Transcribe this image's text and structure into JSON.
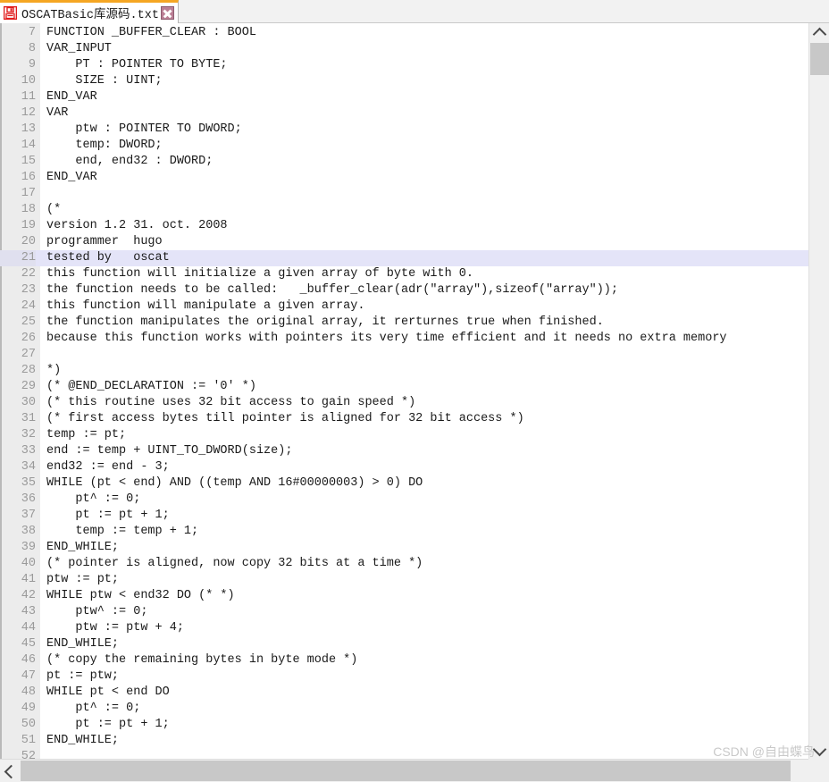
{
  "window": {
    "tab": {
      "title": "OSCATBasic库源码.txt",
      "icon": "save-floppy-icon",
      "close_label": "×",
      "active_indicator_color": "#f5a623"
    }
  },
  "editor": {
    "gutter_color": "#ececec",
    "line_number_color": "#9a9a9a",
    "highlight_color": "#e4e4f8",
    "current_line": 21,
    "first_visible_line": 7,
    "last_visible_line": 52,
    "lines": [
      {
        "n": "7",
        "text": "FUNCTION _BUFFER_CLEAR : BOOL"
      },
      {
        "n": "8",
        "text": "VAR_INPUT"
      },
      {
        "n": "9",
        "text": "    PT : POINTER TO BYTE;"
      },
      {
        "n": "10",
        "text": "    SIZE : UINT;"
      },
      {
        "n": "11",
        "text": "END_VAR"
      },
      {
        "n": "12",
        "text": "VAR"
      },
      {
        "n": "13",
        "text": "    ptw : POINTER TO DWORD;"
      },
      {
        "n": "14",
        "text": "    temp: DWORD;"
      },
      {
        "n": "15",
        "text": "    end, end32 : DWORD;"
      },
      {
        "n": "16",
        "text": "END_VAR"
      },
      {
        "n": "17",
        "text": ""
      },
      {
        "n": "18",
        "text": "(*"
      },
      {
        "n": "19",
        "text": "version 1.2 31. oct. 2008"
      },
      {
        "n": "20",
        "text": "programmer  hugo"
      },
      {
        "n": "21",
        "text": "tested by   oscat"
      },
      {
        "n": "22",
        "text": "this function will initialize a given array of byte with 0."
      },
      {
        "n": "23",
        "text": "the function needs to be called:   _buffer_clear(adr(\"array\"),sizeof(\"array\"));"
      },
      {
        "n": "24",
        "text": "this function will manipulate a given array."
      },
      {
        "n": "25",
        "text": "the function manipulates the original array, it rerturnes true when finished."
      },
      {
        "n": "26",
        "text": "because this function works with pointers its very time efficient and it needs no extra memory"
      },
      {
        "n": "27",
        "text": ""
      },
      {
        "n": "28",
        "text": "*)"
      },
      {
        "n": "29",
        "text": "(* @END_DECLARATION := '0' *)"
      },
      {
        "n": "30",
        "text": "(* this routine uses 32 bit access to gain speed *)"
      },
      {
        "n": "31",
        "text": "(* first access bytes till pointer is aligned for 32 bit access *)"
      },
      {
        "n": "32",
        "text": "temp := pt;"
      },
      {
        "n": "33",
        "text": "end := temp + UINT_TO_DWORD(size);"
      },
      {
        "n": "34",
        "text": "end32 := end - 3;"
      },
      {
        "n": "35",
        "text": "WHILE (pt < end) AND ((temp AND 16#00000003) > 0) DO"
      },
      {
        "n": "36",
        "text": "    pt^ := 0;"
      },
      {
        "n": "37",
        "text": "    pt := pt + 1;"
      },
      {
        "n": "38",
        "text": "    temp := temp + 1;"
      },
      {
        "n": "39",
        "text": "END_WHILE;"
      },
      {
        "n": "40",
        "text": "(* pointer is aligned, now copy 32 bits at a time *)"
      },
      {
        "n": "41",
        "text": "ptw := pt;"
      },
      {
        "n": "42",
        "text": "WHILE ptw < end32 DO (* *)"
      },
      {
        "n": "43",
        "text": "    ptw^ := 0;"
      },
      {
        "n": "44",
        "text": "    ptw := ptw + 4;"
      },
      {
        "n": "45",
        "text": "END_WHILE;"
      },
      {
        "n": "46",
        "text": "(* copy the remaining bytes in byte mode *)"
      },
      {
        "n": "47",
        "text": "pt := ptw;"
      },
      {
        "n": "48",
        "text": "WHILE pt < end DO"
      },
      {
        "n": "49",
        "text": "    pt^ := 0;"
      },
      {
        "n": "50",
        "text": "    pt := pt + 1;"
      },
      {
        "n": "51",
        "text": "END_WHILE;"
      },
      {
        "n": "52",
        "text": ""
      }
    ]
  },
  "scrollbars": {
    "vertical": {
      "up_arrow": "chevron-up-icon",
      "down_arrow": "chevron-down-icon",
      "thumb_color": "#c8c8c8"
    },
    "horizontal": {
      "left_arrow": "chevron-left-icon",
      "thumb_color": "#c8c8c8"
    }
  },
  "watermark": {
    "text": "CSDN @自由蝶鸟"
  }
}
